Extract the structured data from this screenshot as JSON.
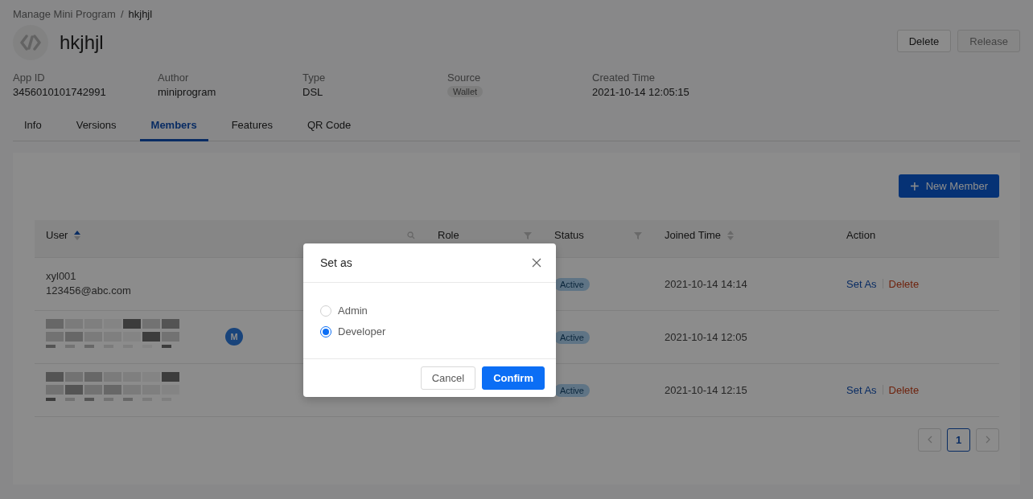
{
  "breadcrumb": {
    "items": [
      {
        "label": "Manage Mini Program",
        "current": false
      },
      {
        "label": "hkjhjl",
        "current": true
      }
    ],
    "separator": "/"
  },
  "app": {
    "name": "hkjhjl"
  },
  "header_buttons": [
    {
      "label": "Delete",
      "disabled": false
    },
    {
      "label": "Release",
      "disabled": true
    }
  ],
  "details": [
    {
      "label": "App ID",
      "value": "3456010101742991",
      "kind": "text"
    },
    {
      "label": "Author",
      "value": "miniprogram",
      "kind": "text"
    },
    {
      "label": "Type",
      "value": "DSL",
      "kind": "text"
    },
    {
      "label": "Source",
      "value": "Wallet",
      "kind": "tag"
    },
    {
      "label": "Created Time",
      "value": "2021-10-14 12:05:15",
      "kind": "text"
    }
  ],
  "tabs": [
    {
      "label": "Info",
      "selected": false
    },
    {
      "label": "Versions",
      "selected": false
    },
    {
      "label": "Members",
      "selected": true
    },
    {
      "label": "Features",
      "selected": false
    },
    {
      "label": "QR Code",
      "selected": false
    }
  ],
  "new_member_button": {
    "icon": "+",
    "label": "New Member"
  },
  "table": {
    "columns": [
      {
        "label": "User",
        "kind": "sort",
        "sorted": true,
        "search": true
      },
      {
        "label": "Role",
        "kind": "filter"
      },
      {
        "label": "Status",
        "kind": "filter"
      },
      {
        "label": "Joined Time",
        "kind": "sort",
        "sorted": false
      },
      {
        "label": "Action",
        "kind": "plain"
      }
    ],
    "rows": [
      {
        "user": {
          "kind": "text",
          "name": "xyl001",
          "email": "123456@abc.com"
        },
        "status": "Active",
        "joined": "2021-10-14 14:14",
        "actions": [
          {
            "label": "Set As",
            "kind": "primary"
          },
          {
            "label": "Delete",
            "kind": "danger"
          }
        ]
      },
      {
        "user": {
          "kind": "pixelated",
          "avatar": "M"
        },
        "status": "Active",
        "joined": "2021-10-14 12:05"
      },
      {
        "user": {
          "kind": "pixelated"
        },
        "status": "Active",
        "joined": "2021-10-14 12:15",
        "actions": [
          {
            "label": "Set As",
            "kind": "primary"
          },
          {
            "label": "Delete",
            "kind": "danger"
          }
        ]
      }
    ]
  },
  "pagination": {
    "pages": [
      {
        "label": "1",
        "selected": true
      }
    ]
  },
  "dialog": {
    "title": "Set as",
    "options": [
      {
        "label": "Admin",
        "selected": false
      },
      {
        "label": "Developer",
        "selected": true
      }
    ],
    "buttons": [
      {
        "label": "Cancel",
        "kind": "default"
      },
      {
        "label": "Confirm",
        "kind": "primary"
      }
    ]
  }
}
